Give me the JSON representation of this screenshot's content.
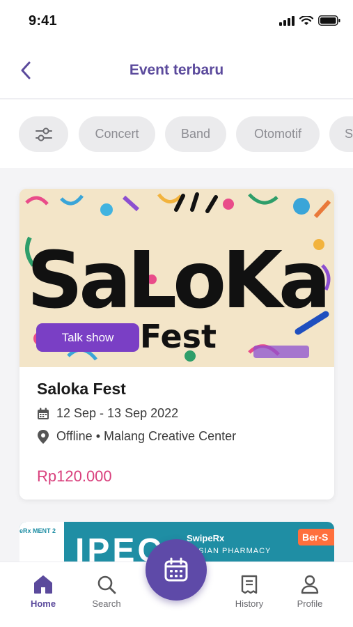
{
  "status_bar": {
    "time": "9:41"
  },
  "header": {
    "title": "Event terbaru",
    "back_icon": "chevron-left-icon"
  },
  "filters": {
    "filter_icon": "sliders-icon",
    "chips": [
      "Concert",
      "Band",
      "Otomotif",
      "S"
    ]
  },
  "events": [
    {
      "banner_title": "SaLoKa",
      "banner_subtitle": "Fest",
      "category": "Talk show",
      "title": "Saloka Fest",
      "date": "12 Sep - 13 Sep 2022",
      "location": "Offline • Malang Creative Center",
      "price": "Rp120.000"
    },
    {
      "left_text": "eRx  MENT 2",
      "big_text": "IPEC",
      "brand": "SwipeRx",
      "subtitle": "NESIAN PHARMACY",
      "tag": "Ber-S"
    }
  ],
  "bottom_nav": {
    "items": [
      {
        "label": "Home",
        "icon": "home-icon",
        "active": true
      },
      {
        "label": "Search",
        "icon": "search-icon",
        "active": false
      },
      {
        "label": "History",
        "icon": "receipt-icon",
        "active": false
      },
      {
        "label": "Profile",
        "icon": "user-icon",
        "active": false
      }
    ],
    "fab_icon": "calendar-icon"
  },
  "colors": {
    "primary": "#5b4a9c",
    "price": "#d9407d",
    "badge": "#7a3fc5",
    "chip_bg": "#ebebed"
  }
}
